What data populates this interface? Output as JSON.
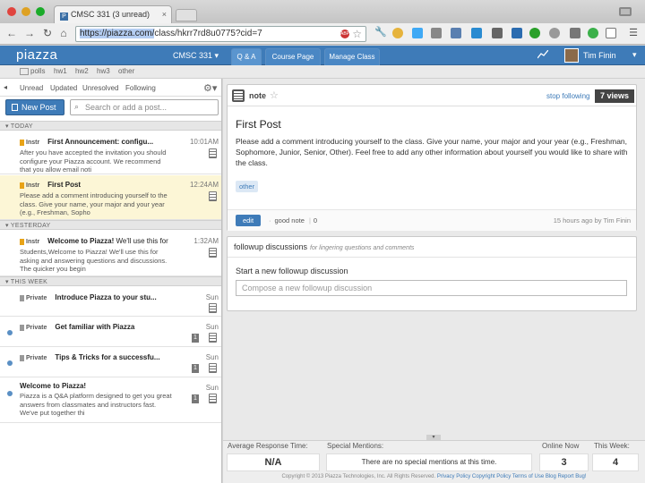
{
  "browser": {
    "tab_title": "CMSC 331 (3 unread)",
    "url_highlight": "https://piazza.com/",
    "url_rest": "class/hkrr7rd8u0775?cid=7"
  },
  "header": {
    "logo": "piazza",
    "course": "CMSC 331 ▾",
    "tabs": [
      "Q & A",
      "Course Page",
      "Manage Class"
    ],
    "user_name": "Tim Finin"
  },
  "folders": [
    "polls",
    "hw1",
    "hw2",
    "hw3",
    "other"
  ],
  "filters": [
    "Unread",
    "Updated",
    "Unresolved",
    "Following"
  ],
  "new_post_label": "New Post",
  "search_placeholder": "Search or add a post...",
  "groups": {
    "today": "▾ TODAY",
    "yesterday": "▾ YESTERDAY",
    "this_week": "▾ THIS WEEK"
  },
  "posts": [
    {
      "tag": "Instr",
      "title": "First Announcement: configu...",
      "snippet": "After you have accepted the invitation you should configure your Piazza account. We recommend that you allow email noti",
      "time": "10:01AM"
    },
    {
      "tag": "Instr",
      "title": "First Post",
      "snippet": "Please add a comment introducing yourself to the class. Give your name, your major and your year (e.g., Freshman, Sopho",
      "time": "12:24AM"
    },
    {
      "tag": "Instr",
      "title": "Welcome to Piazza!",
      "title_tail": "We'll use this for",
      "snippet": "Students,Welcome to Piazza! We'll use this for asking and answering questions and discussions. The quicker you begin",
      "time": "1:32AM"
    },
    {
      "tag": "Private",
      "title": "Introduce Piazza to your stu...",
      "time": "Sun"
    },
    {
      "tag": "Private",
      "title": "Get familiar with Piazza",
      "time": "Sun",
      "count": "1"
    },
    {
      "tag": "Private",
      "title": "Tips & Tricks for a successfu...",
      "time": "Sun",
      "count": "1"
    },
    {
      "title": "Welcome to Piazza!",
      "snippet": "Piazza is a Q&A platform designed to get you great answers from classmates and instructors fast. We've put together thi",
      "time": "Sun",
      "count": "1"
    }
  ],
  "note": {
    "type_label": "note",
    "stop_following": "stop following",
    "views": "7 views",
    "title": "First Post",
    "body": "Please add a comment introducing yourself to the class. Give your name, your major and your year (e.g., Freshman, Sophomore, Junior, Senior, Other). Feel free to add any other information about yourself you would like to share with the class.",
    "folder_tag": "other",
    "edit_label": "edit",
    "good_note": "good note",
    "good_note_count": "0",
    "updated": "15 hours ago by Tim Finin"
  },
  "followup": {
    "heading": "followup discussions",
    "subheading": "for lingering questions and comments",
    "start_label": "Start a new followup discussion",
    "placeholder": "Compose a new followup discussion"
  },
  "stats": {
    "avg_label": "Average Response Time:",
    "avg_value": "N/A",
    "mentions_label": "Special Mentions:",
    "mentions_value": "There are no special mentions at this time.",
    "online_label": "Online Now",
    "online_value": "3",
    "week_label": "This Week:",
    "week_value": "4"
  },
  "footer": {
    "copyright": "Copyright © 2013 Piazza Technologies, Inc. All Rights Reserved.",
    "links": [
      "Privacy Policy",
      "Copyright Policy",
      "Terms of Use",
      "Blog",
      "Report Bug!"
    ]
  }
}
